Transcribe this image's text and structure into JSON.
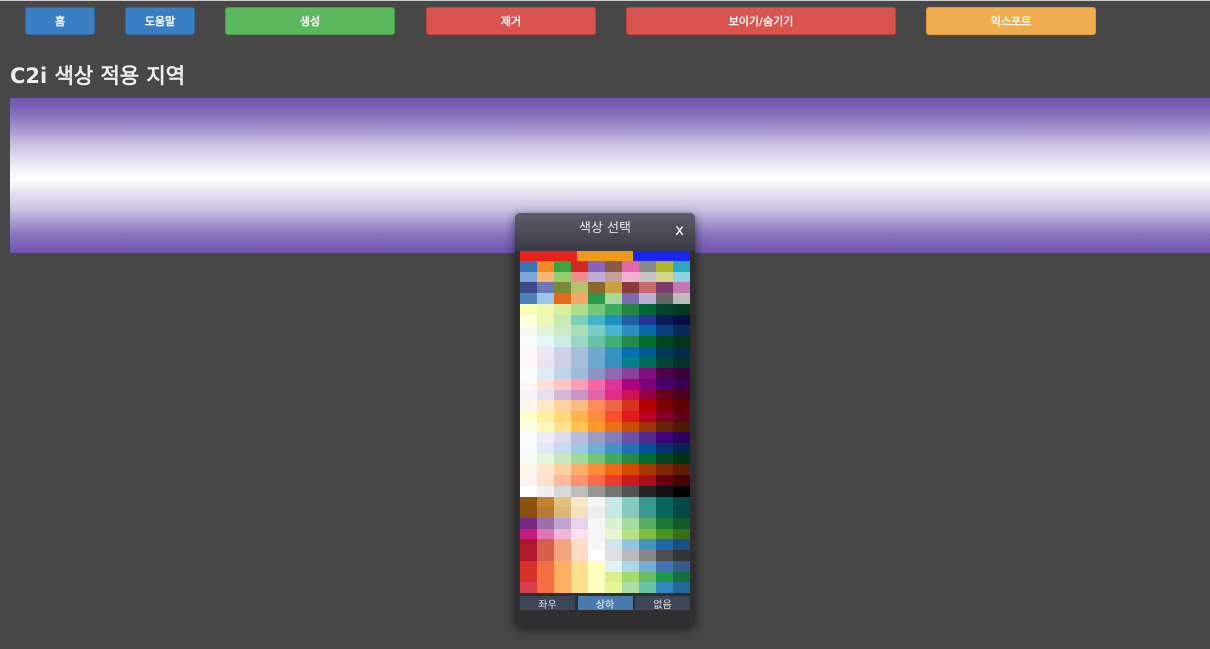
{
  "toolbar": {
    "home": "홈",
    "help": "도움말",
    "create": "생성",
    "remove": "제거",
    "toggle": "보이기/숨기기",
    "export": "익스포트"
  },
  "page_title": "C2i 색상 적용 지역",
  "gradient": {
    "edge_color": "#6f52ad",
    "center_color": "#ffffff"
  },
  "picker": {
    "title": "색상 선택",
    "close_label": "x",
    "top_strip": [
      "#e8211a",
      "#f09a1b",
      "#1a26ee"
    ],
    "modes": {
      "horizontal": "좌우",
      "vertical": "상하",
      "none": "없음"
    },
    "active_mode": "상하",
    "swatch_rows": [
      [
        "#3b6fb6",
        "#f28a21",
        "#3aa53a",
        "#cc2828",
        "#8a64b4",
        "#8a5a46",
        "#e06aaa",
        "#888888",
        "#b4b432",
        "#2aa8c0"
      ],
      [
        "#7da6d8",
        "#f6b870",
        "#94cc6e",
        "#ee8f8f",
        "#c4aad8",
        "#c4a096",
        "#f2b0d0",
        "#c4c4c4",
        "#d6d68a",
        "#8cd2e0"
      ],
      [
        "#3a4a8a",
        "#6d78b8",
        "#7a8a3a",
        "#b8c06a",
        "#8a6a2a",
        "#c8a040",
        "#8a3a3a",
        "#c86a6a",
        "#7a3a6a",
        "#c07ab0"
      ],
      [
        "#4a82c0",
        "#9cc6e6",
        "#e66a1a",
        "#f6a86a",
        "#2a9a4a",
        "#a6d89a",
        "#7a6ab0",
        "#bcb0d6",
        "#666666",
        "#bcbcbc"
      ],
      [
        "#f7fcb9",
        "#f0f9b0",
        "#d9f0a3",
        "#addd8e",
        "#78c679",
        "#41ab5d",
        "#238443",
        "#006837",
        "#004529",
        "#003a22"
      ],
      [
        "#ffffd9",
        "#edf8b1",
        "#c7e9b4",
        "#7fcdbb",
        "#41b6c4",
        "#1d91c0",
        "#225ea8",
        "#253494",
        "#081d58",
        "#081040"
      ],
      [
        "#f7fcf0",
        "#e0f3db",
        "#ccebc5",
        "#a8ddb5",
        "#7bccc4",
        "#4eb3d3",
        "#2b8cbe",
        "#0868ac",
        "#084081",
        "#082a5a"
      ],
      [
        "#f7fcfd",
        "#e5f5f9",
        "#ccece6",
        "#99d8c9",
        "#66c2a4",
        "#41ae76",
        "#238b45",
        "#006d2c",
        "#00441b",
        "#00331a"
      ],
      [
        "#fff7fb",
        "#ece7f2",
        "#d0d1e6",
        "#a6bddb",
        "#74a9cf",
        "#3690c0",
        "#0570b0",
        "#045a8d",
        "#023858",
        "#022a44"
      ],
      [
        "#fff7fb",
        "#ece2f0",
        "#d0d1e6",
        "#a6bddb",
        "#67a9cf",
        "#3690c0",
        "#02818a",
        "#016c59",
        "#014636",
        "#01352a"
      ],
      [
        "#f7fcfd",
        "#e0ecf4",
        "#bfd3e6",
        "#9ebcda",
        "#8c96c6",
        "#8c6bb1",
        "#88419d",
        "#810f7c",
        "#4d004b",
        "#3a0038"
      ],
      [
        "#fff7f3",
        "#fde0dd",
        "#fcc5c0",
        "#fa9fb5",
        "#f768a1",
        "#dd3497",
        "#ae017e",
        "#7a0177",
        "#49006a",
        "#380050"
      ],
      [
        "#f7f4f9",
        "#e7e1ef",
        "#d4b9da",
        "#c994c7",
        "#df65b0",
        "#e7298a",
        "#ce1256",
        "#980043",
        "#67001f",
        "#4a0016"
      ],
      [
        "#fff7ec",
        "#fee8c8",
        "#fdd49e",
        "#fdbb84",
        "#fc8d59",
        "#ef6548",
        "#d7301f",
        "#b30000",
        "#7f0000",
        "#600000"
      ],
      [
        "#ffffcc",
        "#ffeda0",
        "#fed976",
        "#feb24c",
        "#fd8d3c",
        "#fc4e2a",
        "#e31a1c",
        "#bd0026",
        "#800026",
        "#60001c"
      ],
      [
        "#ffffe5",
        "#fff7bc",
        "#fee391",
        "#fec44f",
        "#fe9929",
        "#ec7014",
        "#cc4c02",
        "#993404",
        "#662506",
        "#4a1a04"
      ],
      [
        "#fcfbfd",
        "#efedf5",
        "#dadaeb",
        "#bcbddc",
        "#9e9ac8",
        "#807dba",
        "#6a51a3",
        "#54278f",
        "#3f007d",
        "#2e005c"
      ],
      [
        "#f7fbff",
        "#deebf7",
        "#c6dbef",
        "#9ecae1",
        "#6baed6",
        "#4292c6",
        "#2171b5",
        "#08519c",
        "#08306b",
        "#06244f"
      ],
      [
        "#f7fcf5",
        "#e5f5e0",
        "#c7e9c0",
        "#a1d99b",
        "#74c476",
        "#41ab5d",
        "#238b45",
        "#006d2c",
        "#00441b",
        "#003314"
      ],
      [
        "#fff5eb",
        "#fee6ce",
        "#fdd0a2",
        "#fdae6b",
        "#fd8d3c",
        "#f16913",
        "#d94801",
        "#a63603",
        "#7f2704",
        "#5e1c03"
      ],
      [
        "#fff5f0",
        "#fee0d2",
        "#fcbba1",
        "#fc9272",
        "#fb6a4a",
        "#ef3b2c",
        "#cb181d",
        "#a50f15",
        "#67000d",
        "#4a0009"
      ],
      [
        "#ffffff",
        "#f0f0f0",
        "#d9d9d9",
        "#bdbdbd",
        "#969696",
        "#737373",
        "#525252",
        "#252525",
        "#111111",
        "#000000"
      ],
      [
        "#8c510a",
        "#bf812d",
        "#dfc27d",
        "#f6e8c3",
        "#f5f5f5",
        "#c7eae5",
        "#80cdc1",
        "#35978f",
        "#01665e",
        "#004c44"
      ],
      [
        "#8a4e12",
        "#b87a34",
        "#d9b878",
        "#f2e2c0",
        "#eeeeee",
        "#c8e8e2",
        "#86c8bc",
        "#3c9890",
        "#066a60",
        "#004a42"
      ],
      [
        "#762a83",
        "#9970ab",
        "#c2a5cf",
        "#e7d4e8",
        "#f7f7f7",
        "#d9f0d3",
        "#a6dba0",
        "#5aae61",
        "#1b7837",
        "#125a28"
      ],
      [
        "#c51b7d",
        "#de77ae",
        "#f1b6da",
        "#fde0ef",
        "#f7f7f7",
        "#e6f5d0",
        "#b8e186",
        "#7fbc41",
        "#4d9221",
        "#3a6e18"
      ],
      [
        "#b2182b",
        "#d6604d",
        "#f4a582",
        "#fddbc7",
        "#f7f7f7",
        "#d1e5f0",
        "#92c5de",
        "#4393c3",
        "#2166ac",
        "#194f82"
      ],
      [
        "#b2182b",
        "#d6604d",
        "#f4a582",
        "#fddbc7",
        "#ffffff",
        "#e0e0e0",
        "#bababa",
        "#878787",
        "#4d4d4d",
        "#333333"
      ],
      [
        "#d73027",
        "#f46d43",
        "#fdae61",
        "#fee090",
        "#ffffbf",
        "#e0f3f8",
        "#abd9e9",
        "#74add1",
        "#4575b4",
        "#355a8c"
      ],
      [
        "#d73027",
        "#f46d43",
        "#fdae61",
        "#fee08b",
        "#ffffbf",
        "#d9ef8b",
        "#a6d96a",
        "#66bd63",
        "#1a9850",
        "#136e3a"
      ],
      [
        "#d53e4f",
        "#f46d43",
        "#fdae61",
        "#fee08b",
        "#ffffbf",
        "#e6f598",
        "#abdda4",
        "#66c2a5",
        "#3288bd",
        "#25669c"
      ]
    ]
  }
}
